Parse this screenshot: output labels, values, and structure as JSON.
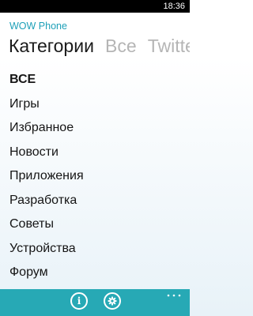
{
  "status_bar": {
    "time": "18:36"
  },
  "app": {
    "title": "WOW Phone"
  },
  "pivot": {
    "items": [
      {
        "label": "Категории",
        "active": true
      },
      {
        "label": "Все",
        "active": false
      },
      {
        "label": "Twitter",
        "active": false
      }
    ]
  },
  "categories": [
    {
      "label": "ВСЕ",
      "bold": true
    },
    {
      "label": "Игры"
    },
    {
      "label": "Избранное"
    },
    {
      "label": "Новости"
    },
    {
      "label": "Приложения"
    },
    {
      "label": "Разработка"
    },
    {
      "label": "Советы"
    },
    {
      "label": "Устройства"
    },
    {
      "label": "Форум"
    }
  ],
  "app_bar": {
    "buttons": [
      {
        "icon": "info-icon"
      },
      {
        "icon": "gear-icon"
      }
    ],
    "more_icon": "more-dots-icon",
    "background": "#27a9b5"
  },
  "colors": {
    "accent": "#1ea0b8",
    "status_bar": "#000000",
    "inactive_pivot": "#b5b5b5"
  }
}
